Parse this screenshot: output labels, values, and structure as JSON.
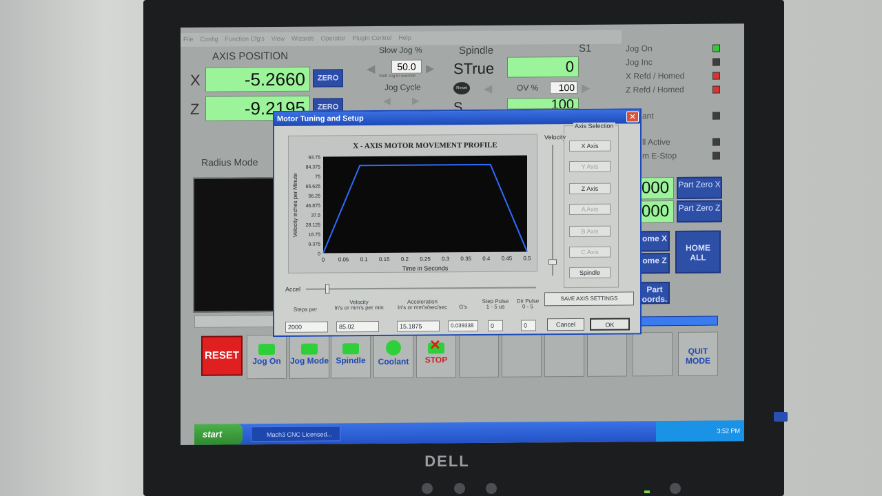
{
  "menu": [
    "File",
    "Config",
    "Function Cfg's",
    "View",
    "Wizards",
    "Operator",
    "PlugIn Control",
    "Help"
  ],
  "axis": {
    "title": "AXIS POSITION",
    "x_label": "X",
    "x_value": "-5.2660",
    "z_label": "Z",
    "z_value": "-9.2195",
    "zero": "ZERO",
    "radius_mode": "Radius Mode"
  },
  "jog": {
    "slow_jog": "Slow Jog %",
    "slow_value": "50.0",
    "shift_hint": "Shift Jog to override",
    "jog_cycle": "Jog Cycle"
  },
  "spindle": {
    "title": "Spindle",
    "s1": "S1",
    "strue_label": "STrue",
    "strue_value": "0",
    "reset_small": "Reset",
    "ov_label": "OV %",
    "ov_value": "100",
    "s_label": "S",
    "s_value": "100"
  },
  "leds": [
    {
      "label": "Jog On",
      "color": "#35c83b"
    },
    {
      "label": "Jog Inc",
      "color": "#3e3e3e"
    },
    {
      "label": "X Refd / Homed",
      "color": "#d83434"
    },
    {
      "label": "Z Refd / Homed",
      "color": "#d83434"
    },
    {
      "label": "ant",
      "color": "#3e3e3e"
    },
    {
      "label": "ll Active",
      "color": "#3e3e3e"
    },
    {
      "label": "m E-Stop",
      "color": "#3e3e3e"
    }
  ],
  "right_panel": {
    "val1": "000",
    "val2": "000",
    "part_zero_x": "Part Zero X",
    "part_zero_z": "Part Zero Z",
    "home_x": "ome X",
    "home_z": "ome Z",
    "home_all": "HOME ALL",
    "part_coords": "Part oords."
  },
  "toolbar": {
    "reset": "RESET",
    "jog_on": "Jog On",
    "jog_mode": "Jog Mode",
    "spindle": "Spindle",
    "coolant": "Coolant",
    "stop": "STOP",
    "quit_mode": "QUIT MODE"
  },
  "dialog": {
    "title": "Motor Tuning and Setup",
    "close": "✕",
    "velocity_label": "Velocity",
    "axis_selection": "Axis Selection",
    "axis_buttons": [
      "X Axis",
      "Y Axis",
      "Z Axis",
      "A Axis",
      "B Axis",
      "C Axis",
      "Spindle"
    ],
    "accel_label": "Accel",
    "headers": {
      "steps_per": "Steps per",
      "velocity": "Velocity",
      "velocity_unit": "In's or mm's per min",
      "acceleration": "Acceleration",
      "acceleration_unit": "In's or mm's/sec/sec",
      "gs": "G's",
      "step_pulse": "Step Pulse",
      "step_pulse_range": "1 - 5 us",
      "dir_pulse": "Dir Pulse",
      "dir_pulse_range": "0 - 5"
    },
    "values": {
      "steps_per": "2000",
      "velocity": "85.02",
      "acceleration": "15.1875",
      "gs": "0.039338",
      "step_pulse": "0",
      "dir_pulse": "0"
    },
    "save": "SAVE AXIS SETTINGS",
    "cancel": "Cancel",
    "ok": "OK"
  },
  "chart_data": {
    "type": "line",
    "title": "X - AXIS MOTOR MOVEMENT PROFILE",
    "xlabel": "Time in Seconds",
    "ylabel": "Velocity inches per Minute",
    "x_ticks": [
      "0",
      "0.05",
      "0.1",
      "0.15",
      "0.2",
      "0.25",
      "0.3",
      "0.35",
      "0.4",
      "0.45",
      "0.5"
    ],
    "y_ticks": [
      "0",
      "9.375",
      "18.75",
      "28.125",
      "37.5",
      "46.875",
      "56.25",
      "65.625",
      "75",
      "84.375",
      "93.75"
    ],
    "xlim": [
      0,
      0.5
    ],
    "ylim": [
      0,
      93.75
    ],
    "series": [
      {
        "x": [
          0.0,
          0.09,
          0.41,
          0.5
        ],
        "y": [
          0,
          85.02,
          85.02,
          0
        ]
      }
    ],
    "line_color": "#2f6bff",
    "background": "#0a0a0a",
    "grid": false
  },
  "taskbar": {
    "start": "start",
    "task": "Mach3 CNC Licensed...",
    "clock": "3:52 PM"
  },
  "monitor_brand": "DELL"
}
